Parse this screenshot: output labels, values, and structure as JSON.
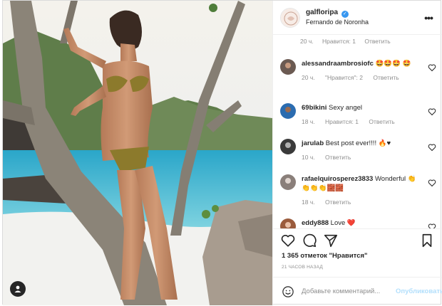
{
  "post": {
    "username": "galfloripa",
    "verified": true,
    "location": "Fernando de Noronha",
    "more_label": "•••"
  },
  "comments_area": {
    "top_meta": {
      "time": "20 ч.",
      "likes": "Нравится: 1",
      "reply": "Ответить"
    },
    "comments": [
      {
        "user": "alessandraambrosiofc",
        "text": "🤩🤩🤩 🤩",
        "time": "20 ч.",
        "likes": "\"Нравится\": 2",
        "reply": "Ответить",
        "avatar_color": "#6b5a52"
      },
      {
        "user": "69bikini",
        "text": "Sexy angel",
        "time": "18 ч.",
        "likes": "Нравится: 1",
        "reply": "Ответить",
        "avatar_color": "#2b6cb0"
      },
      {
        "user": "jarulab",
        "text": "Best post ever!!!! 🔥♥",
        "time": "10 ч.",
        "likes": "",
        "reply": "Ответить",
        "avatar_color": "#3a3a3a"
      },
      {
        "user": "rafaelquirosperez3833",
        "text": "Wonderful 👏👏👏👏🧱🧱",
        "time": "18 ч.",
        "likes": "",
        "reply": "Ответить",
        "avatar_color": "#8a7f7a"
      },
      {
        "user": "eddy888",
        "text": "Love ❤️",
        "time": "",
        "likes": "",
        "reply": "",
        "avatar_color": "#9a5b3c"
      }
    ]
  },
  "actions": {
    "likes_count": "1 365 отметок",
    "likes_link": "\"Нравится\"",
    "timestamp": "21 ЧАСОВ НАЗАД"
  },
  "add_comment": {
    "placeholder": "Добавьте комментарий...",
    "post_label": "Опубликовать"
  },
  "icons": {
    "like": "heart-icon",
    "comment": "comment-icon",
    "share": "share-icon",
    "save": "bookmark-icon",
    "emoji": "smiley-icon",
    "user_tag": "user-icon"
  },
  "colors": {
    "accent": "#3897f0",
    "post_disabled": "#b2dffc",
    "muted": "#8e8e8e"
  }
}
